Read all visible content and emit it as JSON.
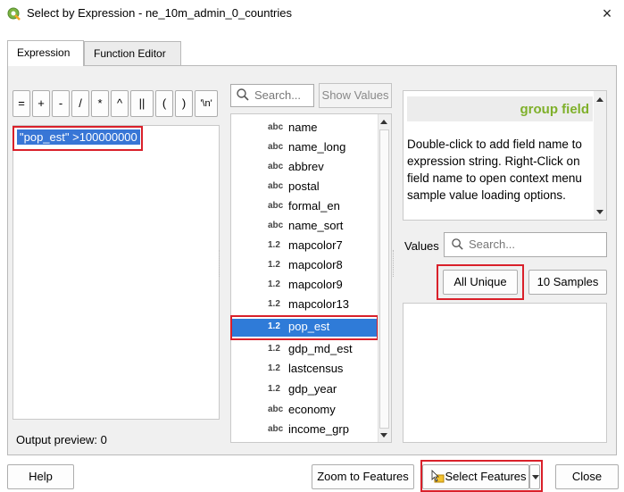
{
  "window": {
    "title": "Select by Expression - ne_10m_admin_0_countries",
    "close_glyph": "×"
  },
  "tabs": [
    {
      "label": "Expression",
      "active": true
    },
    {
      "label": "Function Editor",
      "active": false
    }
  ],
  "operators": [
    "=",
    "+",
    "-",
    "/",
    "*",
    "^",
    "||",
    "(",
    ")",
    "'\\n'"
  ],
  "expression": {
    "text": "\"pop_est\" >100000000",
    "output_preview": "Output preview:  0"
  },
  "search": {
    "placeholder": "Search...",
    "show_values_label": "Show Values"
  },
  "fields": [
    {
      "type": "abc",
      "name": "name"
    },
    {
      "type": "abc",
      "name": "name_long"
    },
    {
      "type": "abc",
      "name": "abbrev"
    },
    {
      "type": "abc",
      "name": "postal"
    },
    {
      "type": "abc",
      "name": "formal_en"
    },
    {
      "type": "abc",
      "name": "name_sort"
    },
    {
      "type": "1.2",
      "name": "mapcolor7"
    },
    {
      "type": "1.2",
      "name": "mapcolor8"
    },
    {
      "type": "1.2",
      "name": "mapcolor9"
    },
    {
      "type": "1.2",
      "name": "mapcolor13"
    },
    {
      "type": "1.2",
      "name": "pop_est",
      "selected": true
    },
    {
      "type": "1.2",
      "name": "gdp_md_est"
    },
    {
      "type": "1.2",
      "name": "lastcensus"
    },
    {
      "type": "1.2",
      "name": "gdp_year"
    },
    {
      "type": "abc",
      "name": "economy"
    },
    {
      "type": "abc",
      "name": "income_grp"
    }
  ],
  "help": {
    "title": "group field",
    "body": "Double-click to add field name to expression string. Right-Click on field name to open context menu sample value loading options."
  },
  "values": {
    "label": "Values",
    "search_placeholder": "Search...",
    "all_unique_label": "All Unique",
    "ten_samples_label": "10 Samples"
  },
  "buttons": {
    "help": "Help",
    "zoom_to_features": "Zoom to Features",
    "select_features": "Select Features",
    "close": "Close"
  },
  "colors": {
    "selection": "#2f7bd8",
    "highlight_border": "#d9202a",
    "help_title": "#7fb02a"
  },
  "icons": {
    "app": "qgis-logo-icon",
    "search": "search-icon",
    "select": "select-features-icon"
  }
}
